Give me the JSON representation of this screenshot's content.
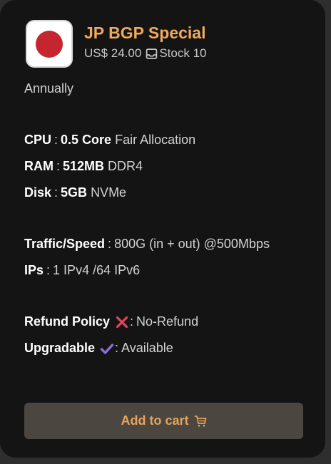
{
  "product": {
    "title": "JP BGP Special",
    "price": "US$ 24.00",
    "stock": "Stock 10",
    "billing": "Annually"
  },
  "specs": {
    "cpu_label": "CPU",
    "cpu_value": "0.5 Core",
    "cpu_note": "Fair Allocation",
    "ram_label": "RAM",
    "ram_value": "512MB",
    "ram_note": "DDR4",
    "disk_label": "Disk",
    "disk_value": "5GB",
    "disk_note": "NVMe",
    "traffic_label": "Traffic/Speed",
    "traffic_value": "800G (in + out) @500Mbps",
    "ips_label": "IPs",
    "ips_value": "1 IPv4 /64 IPv6",
    "refund_label": "Refund Policy",
    "refund_value": "No-Refund",
    "upgrade_label": "Upgradable",
    "upgrade_value": "Available"
  },
  "button": {
    "add_to_cart": "Add to cart"
  },
  "icons": {
    "flag": "japan-flag-icon",
    "stock": "inbox-icon",
    "refund": "cross-mark-icon",
    "upgrade": "check-mark-icon",
    "cart": "cart-icon"
  },
  "colors": {
    "accent": "#f0aa5c",
    "card_bg": "#141414",
    "button_bg": "#4b4640",
    "flag_red": "#c4252f",
    "cross": "#e0465c",
    "check": "#8b6fd6"
  }
}
